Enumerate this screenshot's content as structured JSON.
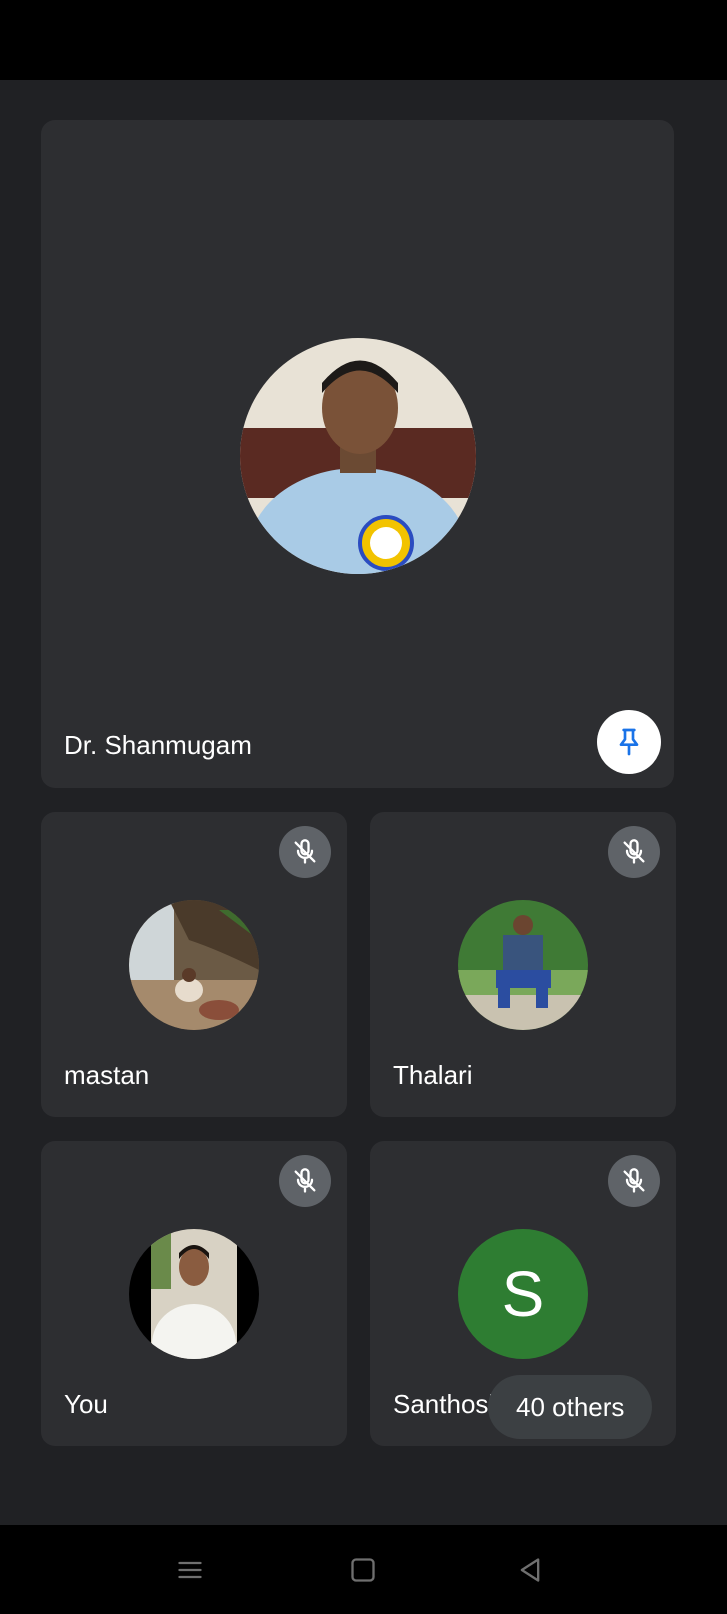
{
  "participants": {
    "featured": {
      "name": "Dr. Shanmugam"
    },
    "tiles": [
      {
        "name": "mastan"
      },
      {
        "name": "Thalari"
      },
      {
        "name": "You"
      },
      {
        "name": "Santhosh",
        "initial": "S",
        "avatar_color": "#2e7d32"
      }
    ],
    "others_label": "40 others"
  },
  "icons": {
    "pin": "pin-icon",
    "mute": "mic-off-icon",
    "nav_menu": "recents-icon",
    "nav_home": "home-icon",
    "nav_back": "back-icon"
  },
  "colors": {
    "background": "#202124",
    "tile": "#2d2e31",
    "pin_accent": "#1a73e8"
  }
}
